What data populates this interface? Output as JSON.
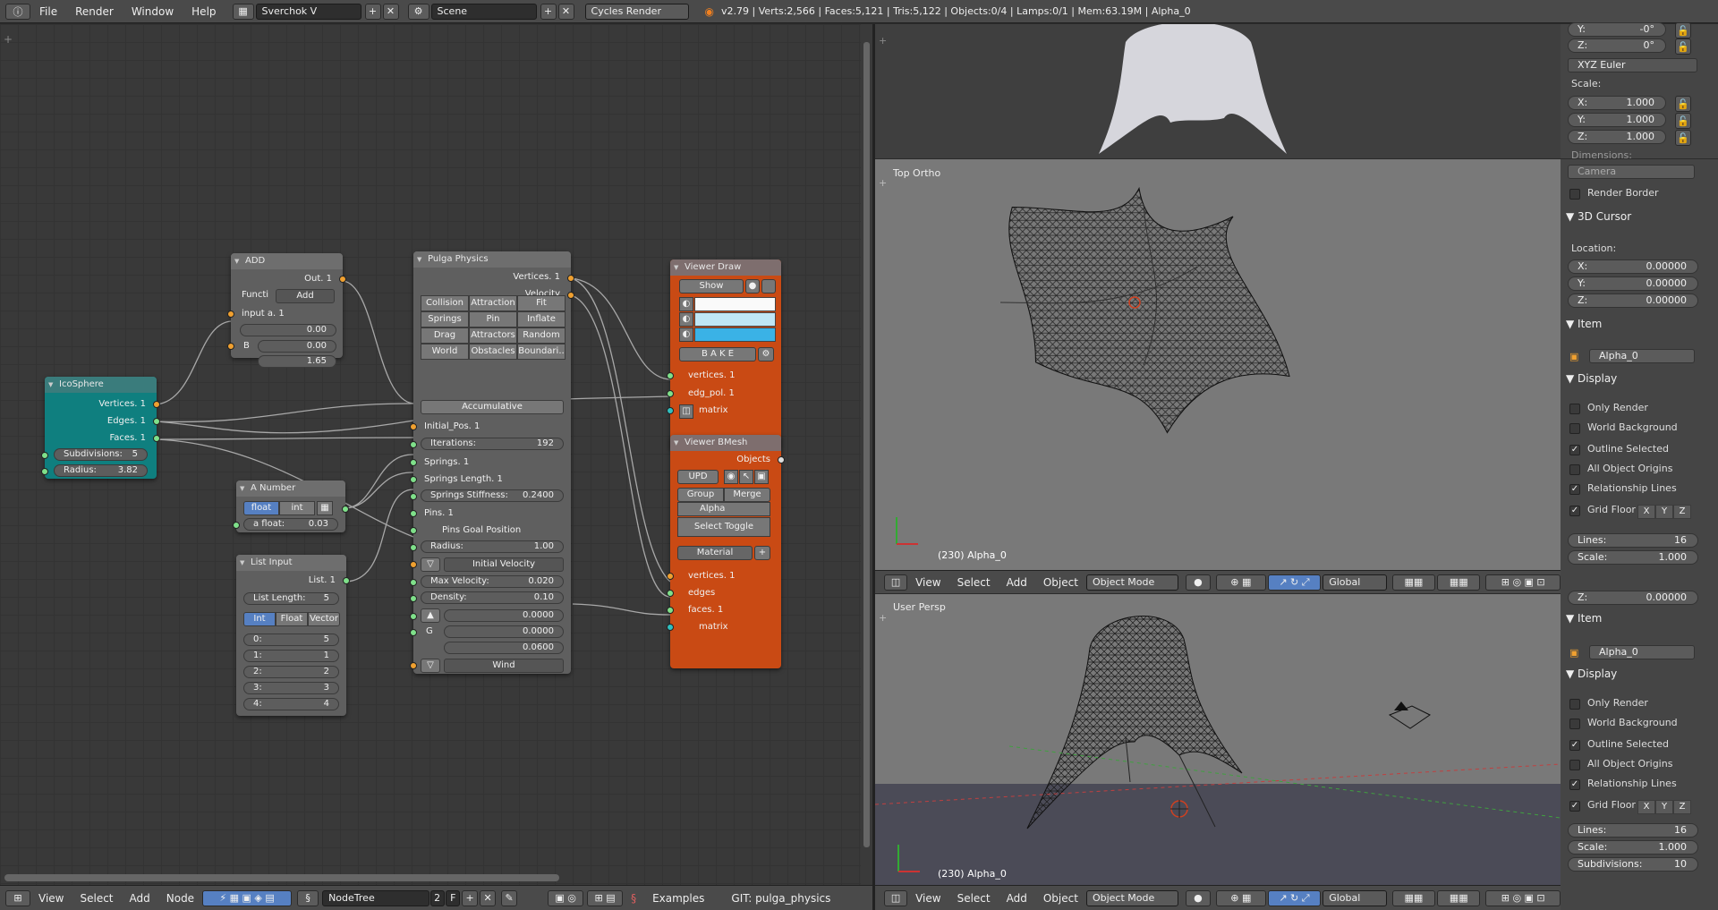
{
  "topbar": {
    "menus": [
      "File",
      "Render",
      "Window",
      "Help"
    ],
    "screen": "Sverchok V",
    "scene": "Scene",
    "engine": "Cycles Render",
    "info": "v2.79 | Verts:2,566 | Faces:5,121 | Tris:5,122 | Objects:0/4 | Lamps:0/1 | Mem:63.19M | Alpha_0"
  },
  "nodes": {
    "icosphere": {
      "title": "IcoSphere",
      "out_vertices": "Vertices. 1",
      "out_edges": "Edges. 1",
      "out_faces": "Faces. 1",
      "subdiv_label": "Subdivisions:",
      "subdiv_value": "5",
      "radius_label": "Radius:",
      "radius_value": "3.82"
    },
    "add": {
      "title": "ADD",
      "out": "Out. 1",
      "func_label": "Functi",
      "func_value": "Add",
      "input_a": "input a. 1",
      "v1": "0.00",
      "b_label": "B",
      "v2": "0.00",
      "v3": "1.65"
    },
    "anumber": {
      "title": "A Number",
      "float": "float",
      "int": "int",
      "afloat_label": "a float:",
      "afloat_value": "0.03"
    },
    "listinput": {
      "title": "List Input",
      "out": "List. 1",
      "len_label": "List Length:",
      "len_value": "5",
      "tabs": [
        "Int",
        "Float",
        "Vector"
      ],
      "items": [
        {
          "k": "0:",
          "v": "5"
        },
        {
          "k": "1:",
          "v": "1"
        },
        {
          "k": "2:",
          "v": "2"
        },
        {
          "k": "3:",
          "v": "3"
        },
        {
          "k": "4:",
          "v": "4"
        }
      ]
    },
    "pulga": {
      "title": "Pulga Physics",
      "out_vertices": "Vertices. 1",
      "out_velocity": "Velocity",
      "grid": [
        "Collision",
        "Attraction",
        "Fit",
        "Springs",
        "Pin",
        "Inflate",
        "Drag",
        "Attractors",
        "Random",
        "World",
        "Obstacles",
        "Boundari.."
      ],
      "accumulative": "Accumulative",
      "initial_pos": "Initial_Pos. 1",
      "iterations_label": "Iterations:",
      "iterations_value": "192",
      "springs": "Springs. 1",
      "springs_length": "Springs Length. 1",
      "stiffness_label": "Springs Stiffness:",
      "stiffness_value": "0.2400",
      "pins": "Pins. 1",
      "pins_goal": "Pins Goal Position",
      "radius_label": "Radius:",
      "radius_value": "1.00",
      "initial_velocity": "Initial Velocity",
      "maxvel_label": "Max Velocity:",
      "maxvel_value": "0.020",
      "density_label": "Density:",
      "density_value": "0.10",
      "g1": "0.0000",
      "g_label": "G",
      "g2": "0.0000",
      "g3": "0.0600",
      "wind": "Wind"
    },
    "viewerdraw": {
      "title": "Viewer Draw",
      "show": "Show",
      "bake": "B A K E",
      "in_vertices": "vertices. 1",
      "in_edgpol": "edg_pol. 1",
      "in_matrix": "matrix"
    },
    "viewerbmesh": {
      "title": "Viewer BMesh",
      "out_objects": "Objects",
      "upd": "UPD",
      "group": "Group",
      "merge": "Merge",
      "name": "Alpha",
      "select_toggle": "Select Toggle",
      "material": "Material",
      "in_vertices": "vertices. 1",
      "in_edges": "edges",
      "in_faces": "faces. 1",
      "in_matrix": "matrix"
    }
  },
  "node_bottom": {
    "menus": [
      "View",
      "Select",
      "Add",
      "Node"
    ],
    "tree": "NodeTree",
    "users": "2",
    "fake": "F",
    "examples": "Examples",
    "git": "GIT: pulga_physics"
  },
  "viewport_top": {
    "label": "Top Ortho",
    "object": "(230) Alpha_0",
    "menus": [
      "View",
      "Select",
      "Add",
      "Object"
    ],
    "mode": "Object Mode",
    "orient": "Global"
  },
  "viewport_persp": {
    "label": "User Persp",
    "object": "(230) Alpha_0",
    "menus": [
      "View",
      "Select",
      "Add",
      "Object"
    ],
    "mode": "Object Mode",
    "orient": "Global"
  },
  "props_top": {
    "y_label": "Y:",
    "y_value": "-0°",
    "z_label": "Z:",
    "z_value": "0°",
    "rot_mode": "XYZ Euler",
    "scale_label": "Scale:",
    "sx_label": "X:",
    "sx": "1.000",
    "sy_label": "Y:",
    "sy": "1.000",
    "sz_label": "Z:",
    "sz": "1.000",
    "dimensions": "Dimensions:"
  },
  "props_mid": {
    "camera": "Camera",
    "render_border": "Render Border",
    "cursor_title": "3D Cursor",
    "location": "Location:",
    "cx_label": "X:",
    "cx": "0.00000",
    "cy_label": "Y:",
    "cy": "0.00000",
    "cz_label": "Z:",
    "cz": "0.00000",
    "item_title": "Item",
    "item_name": "Alpha_0",
    "display_title": "Display",
    "only_render": "Only Render",
    "world_bg": "World Background",
    "outline_sel": "Outline Selected",
    "all_origins": "All Object Origins",
    "rel_lines": "Relationship Lines",
    "grid_floor": "Grid Floor",
    "axes": [
      "X",
      "Y",
      "Z"
    ],
    "lines_label": "Lines:",
    "lines_value": "16",
    "scale_label": "Scale:",
    "scale_value": "1.000"
  },
  "props_bot": {
    "z_label": "Z:",
    "z_value": "0.00000",
    "item_title": "Item",
    "item_name": "Alpha_0",
    "display_title": "Display",
    "only_render": "Only Render",
    "world_bg": "World Background",
    "outline_sel": "Outline Selected",
    "all_origins": "All Object Origins",
    "rel_lines": "Relationship Lines",
    "grid_floor": "Grid Floor",
    "axes": [
      "X",
      "Y",
      "Z"
    ],
    "lines_label": "Lines:",
    "lines_value": "16",
    "scale_label": "Scale:",
    "scale_value": "1.000",
    "subdiv_label": "Subdivisions:",
    "subdiv_value": "10"
  },
  "colors": {
    "teal_node": "#0f7f7f",
    "orange_node": "#c94a14",
    "socket_orange": "#f0a030",
    "socket_green": "#7fe08a",
    "active_blue": "#5680c2"
  }
}
